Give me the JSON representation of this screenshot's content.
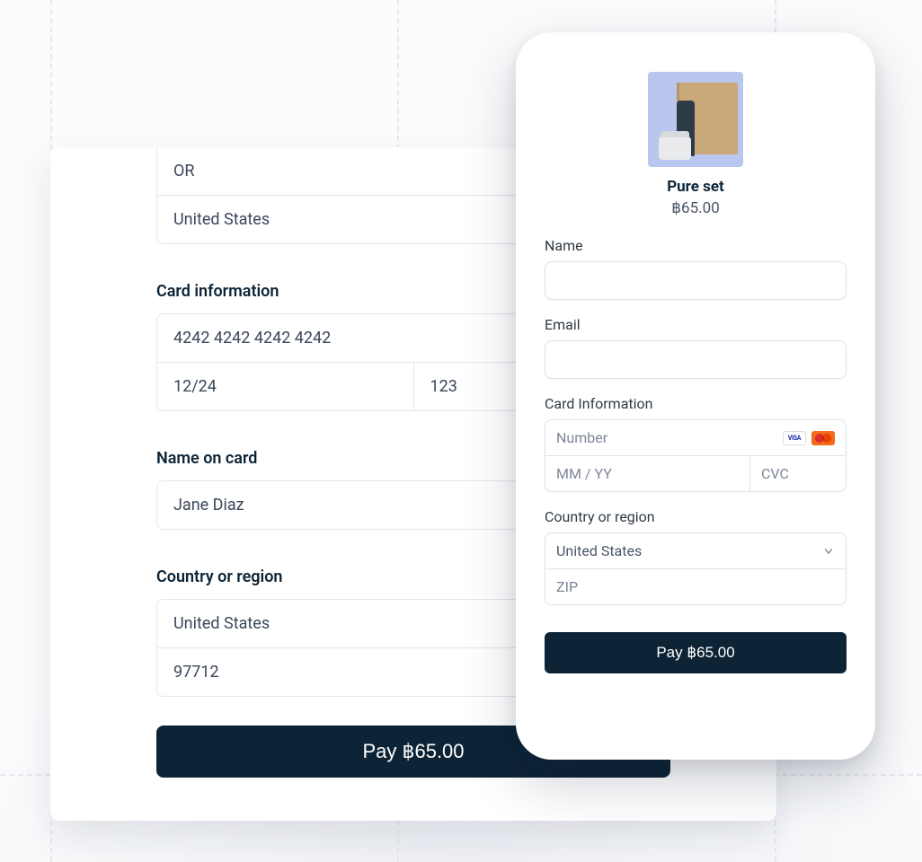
{
  "desktop": {
    "state_value": "OR",
    "country_value_top": "United States",
    "card_info_label": "Card information",
    "card_number": "4242 4242 4242 4242",
    "card_expiry": "12/24",
    "card_cvc": "123",
    "name_label": "Name on card",
    "name_value": "Jane Diaz",
    "region_label": "Country or region",
    "region_country": "United States",
    "region_zip": "97712",
    "pay_label": "Pay ฿65.00"
  },
  "mobile": {
    "product_name": "Pure set",
    "product_price": "฿65.00",
    "name_label": "Name",
    "email_label": "Email",
    "card_info_label": "Card Information",
    "card_number_placeholder": "Number",
    "card_expiry_placeholder": "MM / YY",
    "card_cvc_placeholder": "CVC",
    "region_label": "Country or region",
    "region_country": "United States",
    "region_zip_placeholder": "ZIP",
    "pay_label": "Pay ฿65.00",
    "brands": {
      "visa": "VISA"
    }
  }
}
